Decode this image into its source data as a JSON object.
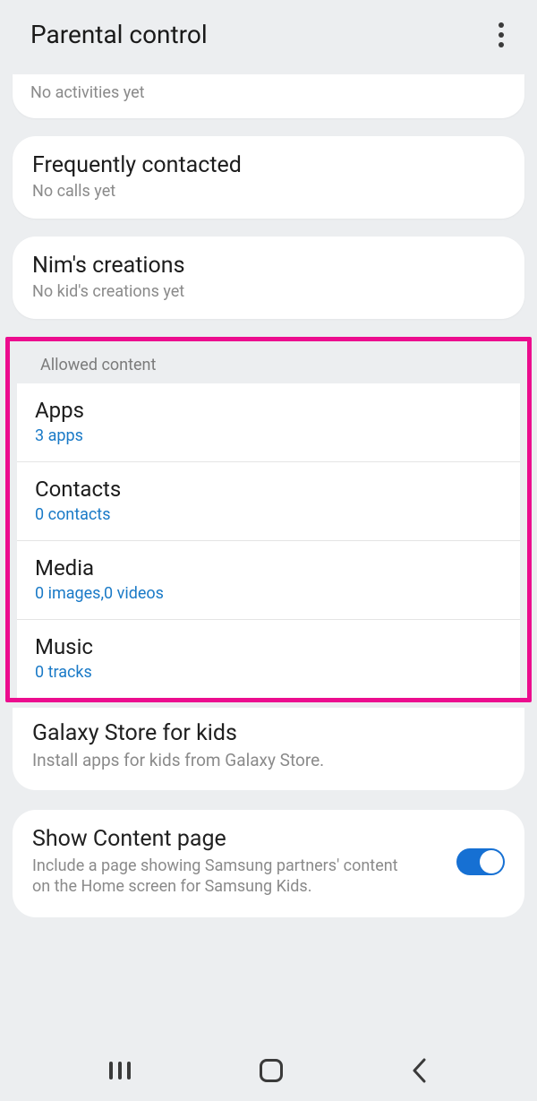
{
  "header": {
    "title": "Parental control"
  },
  "activities": {
    "empty": "No activities yet"
  },
  "frequently": {
    "title": "Frequently contacted",
    "sub": "No calls yet"
  },
  "creations": {
    "title": "Nim's creations",
    "sub": "No kid's creations yet"
  },
  "allowed": {
    "label": "Allowed content",
    "items": [
      {
        "title": "Apps",
        "sub": "3 apps"
      },
      {
        "title": "Contacts",
        "sub": "0 contacts"
      },
      {
        "title": "Media",
        "sub": "0 images,0 videos"
      },
      {
        "title": "Music",
        "sub": "0 tracks"
      }
    ]
  },
  "galaxy": {
    "title": "Galaxy Store for kids",
    "sub": "Install apps for kids from Galaxy Store."
  },
  "contentPage": {
    "title": "Show Content page",
    "sub": "Include a page showing Samsung partners' content on the Home screen for Samsung Kids.",
    "enabled": true
  }
}
